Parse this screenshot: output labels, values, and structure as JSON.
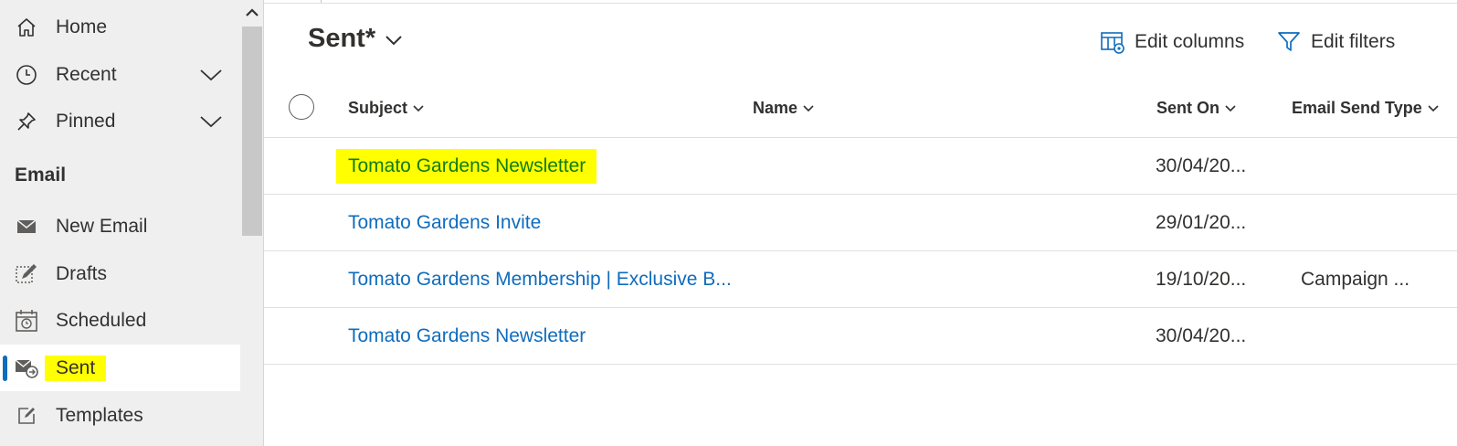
{
  "sidebar": {
    "items": [
      {
        "label": "Home",
        "icon": "home-icon"
      },
      {
        "label": "Recent",
        "icon": "clock-icon",
        "expandable": true
      },
      {
        "label": "Pinned",
        "icon": "pin-icon",
        "expandable": true
      }
    ],
    "section_title": "Email",
    "email_items": [
      {
        "label": "New Email",
        "icon": "envelope-icon"
      },
      {
        "label": "Drafts",
        "icon": "draft-edit-icon"
      },
      {
        "label": "Scheduled",
        "icon": "calendar-clock-icon"
      },
      {
        "label": "Sent",
        "icon": "sent-mail-icon",
        "selected": true
      },
      {
        "label": "Templates",
        "icon": "template-edit-icon"
      }
    ]
  },
  "view": {
    "title": "Sent*"
  },
  "commands": {
    "edit_columns": "Edit columns",
    "edit_filters": "Edit filters"
  },
  "grid": {
    "columns": [
      "Subject",
      "Name",
      "Sent On",
      "Email Send Type"
    ],
    "rows": [
      {
        "subject": "Tomato Gardens Newsletter",
        "name": "",
        "sent_on": "30/04/20...",
        "send_type": "",
        "highlighted": true
      },
      {
        "subject": "Tomato Gardens Invite",
        "name": "",
        "sent_on": "29/01/20...",
        "send_type": ""
      },
      {
        "subject": "Tomato Gardens Membership | Exclusive B...",
        "name": "",
        "sent_on": "19/10/20...",
        "send_type": "Campaign ..."
      },
      {
        "subject": "Tomato Gardens Newsletter",
        "name": "",
        "sent_on": "30/04/20...",
        "send_type": ""
      }
    ]
  },
  "colors": {
    "accent": "#0f6cbd",
    "highlight": "#ffff00",
    "highlight_text": "#107c10",
    "sidebar_bg": "#efefef"
  }
}
